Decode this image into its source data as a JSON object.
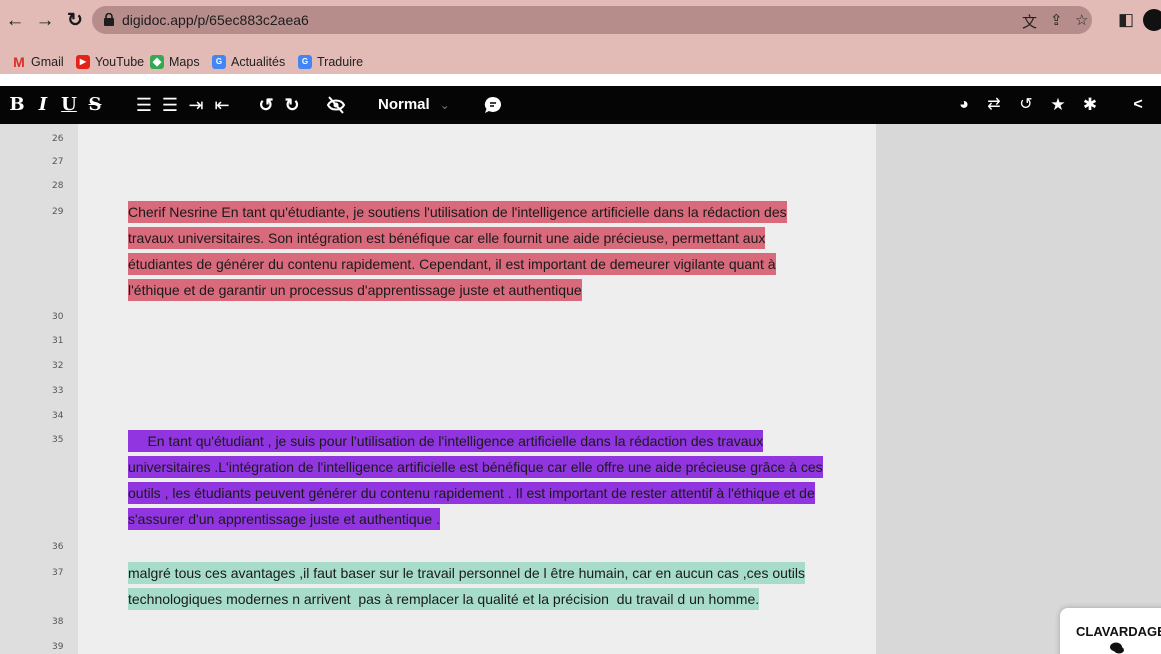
{
  "browser": {
    "url": "digidoc.app/p/65ec883c2aea6",
    "bookmarks": [
      "Gmail",
      "YouTube",
      "Maps",
      "Actualités",
      "Traduire"
    ]
  },
  "toolbar": {
    "bold": "B",
    "italic": "I",
    "underline": "U",
    "strike": "S",
    "format_value": "Normal"
  },
  "document": {
    "line_numbers": [
      "26",
      "27",
      "28",
      "29",
      "30",
      "31",
      "32",
      "33",
      "34",
      "35",
      "36",
      "37",
      "38",
      "39"
    ],
    "paragraphs": {
      "p29": [
        "Cherif Nesrine En tant qu'étudiante, je soutiens l'utilisation de l'intelligence artificielle dans la rédaction des",
        "travaux universitaires. Son intégration est bénéfique car elle fournit une aide précieuse, permettant aux",
        "étudiantes de générer du contenu rapidement. Cependant, il est important de demeurer vigilante quant à",
        "l'éthique et de garantir un processus d'apprentissage juste et authentique"
      ],
      "p35": [
        "     En tant qu'étudiant , je suis pour l'utilisation de l'intelligence artificielle dans la rédaction des travaux",
        "universitaires .L'intégration de l'intelligence artificielle est bénéfique car elle offre une aide précieuse grâce à ces",
        "outils , les étudiants peuvent générer du contenu rapidement . Il est important de rester attentif à l'éthique et de",
        "s'assurer d'un apprentissage juste et authentique ."
      ],
      "p37": [
        "malgré tous ces avantages ,il faut baser sur le travail personnel de l être humain, car en aucun cas ,ces outils",
        "technologiques modernes n arrivent  pas à remplacer la qualité et la précision  du travail d un homme."
      ]
    },
    "colors": {
      "red": "#d96a7c",
      "purple": "#9035e0",
      "teal": "#a7dccb"
    }
  },
  "chat": {
    "label": "CLAVARDAGE"
  }
}
